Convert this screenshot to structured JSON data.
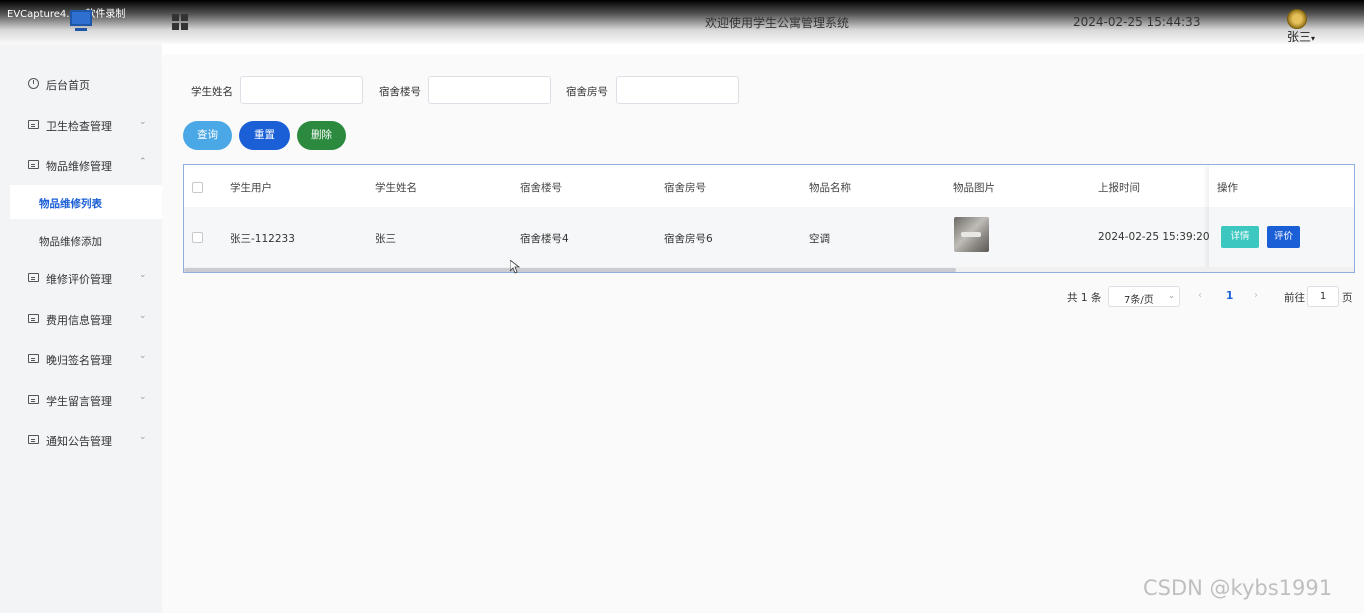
{
  "header": {
    "recorder_watermark": "EVCapture4.1.8软件录制",
    "system_title": "欢迎使用学生公寓管理系统",
    "datetime": "2024-02-25 15:44:33",
    "user_name": "张三",
    "user_caret": "▾"
  },
  "sidebar": {
    "items": [
      {
        "label": "后台首页",
        "icon": "clock-icon"
      },
      {
        "label": "卫生检查管理",
        "icon": "card-icon",
        "chevron": "⌄"
      },
      {
        "label": "物品维修管理",
        "icon": "card-icon",
        "chevron": "⌃"
      },
      {
        "label": "维修评价管理",
        "icon": "card-icon",
        "chevron": "⌄"
      },
      {
        "label": "费用信息管理",
        "icon": "card-icon",
        "chevron": "⌄"
      },
      {
        "label": "晚归签名管理",
        "icon": "card-icon",
        "chevron": "⌄"
      },
      {
        "label": "学生留言管理",
        "icon": "card-icon",
        "chevron": "⌄"
      },
      {
        "label": "通知公告管理",
        "icon": "card-icon",
        "chevron": "⌄"
      }
    ],
    "sub_items": [
      {
        "label": "物品维修列表",
        "active": true
      },
      {
        "label": "物品维修添加",
        "active": false
      }
    ]
  },
  "search": {
    "fields": [
      {
        "label": "学生姓名",
        "value": ""
      },
      {
        "label": "宿舍楼号",
        "value": ""
      },
      {
        "label": "宿舍房号",
        "value": ""
      }
    ],
    "buttons": {
      "query": "查询",
      "reset": "重置",
      "delete": "删除"
    }
  },
  "table": {
    "columns": [
      "学生用户",
      "学生姓名",
      "宿舍楼号",
      "宿舍房号",
      "物品名称",
      "物品图片",
      "上报时间",
      "操作"
    ],
    "rows": [
      {
        "student_user": "张三-112233",
        "student_name": "张三",
        "building": "宿舍楼号4",
        "room": "宿舍房号6",
        "item_name": "空调",
        "report_time": "2024-02-25 15:39:20",
        "actions": {
          "detail": "详情",
          "rate": "评价"
        }
      }
    ]
  },
  "pagination": {
    "total": "共 1 条",
    "page_size": "7条/页",
    "current_page": "1",
    "goto_label": "前往",
    "goto_value": "1",
    "page_unit": "页"
  },
  "colors": {
    "primary": "#1a5fd6",
    "query": "#4aa8e6",
    "delete": "#2b8a3e",
    "detail": "#3cc7c0"
  },
  "footer_watermark": "CSDN @kybs1991"
}
